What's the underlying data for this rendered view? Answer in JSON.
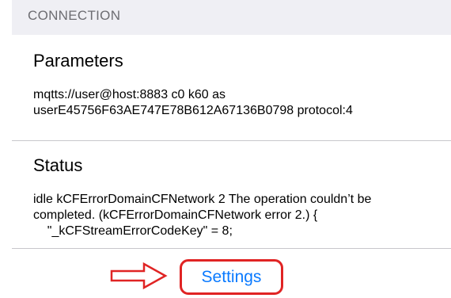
{
  "section": {
    "header": "CONNECTION"
  },
  "parameters": {
    "title": "Parameters",
    "body": "mqtts://user@host:8883 c0 k60 as\nuserE45756F63AE747E78B612A67136B0798 protocol:4"
  },
  "status": {
    "title": "Status",
    "body": "idle kCFErrorDomainCFNetwork 2 The operation couldn’t be completed. (kCFErrorDomainCFNetwork error 2.) {\n    \"_kCFStreamErrorCodeKey\" = 8;"
  },
  "settings_button": {
    "label": "Settings"
  },
  "colors": {
    "accent": "#0a7aff",
    "annotation": "#e02424",
    "section_bg": "#efeff4"
  },
  "icons": {
    "annotation_arrow": "right-arrow-icon"
  }
}
